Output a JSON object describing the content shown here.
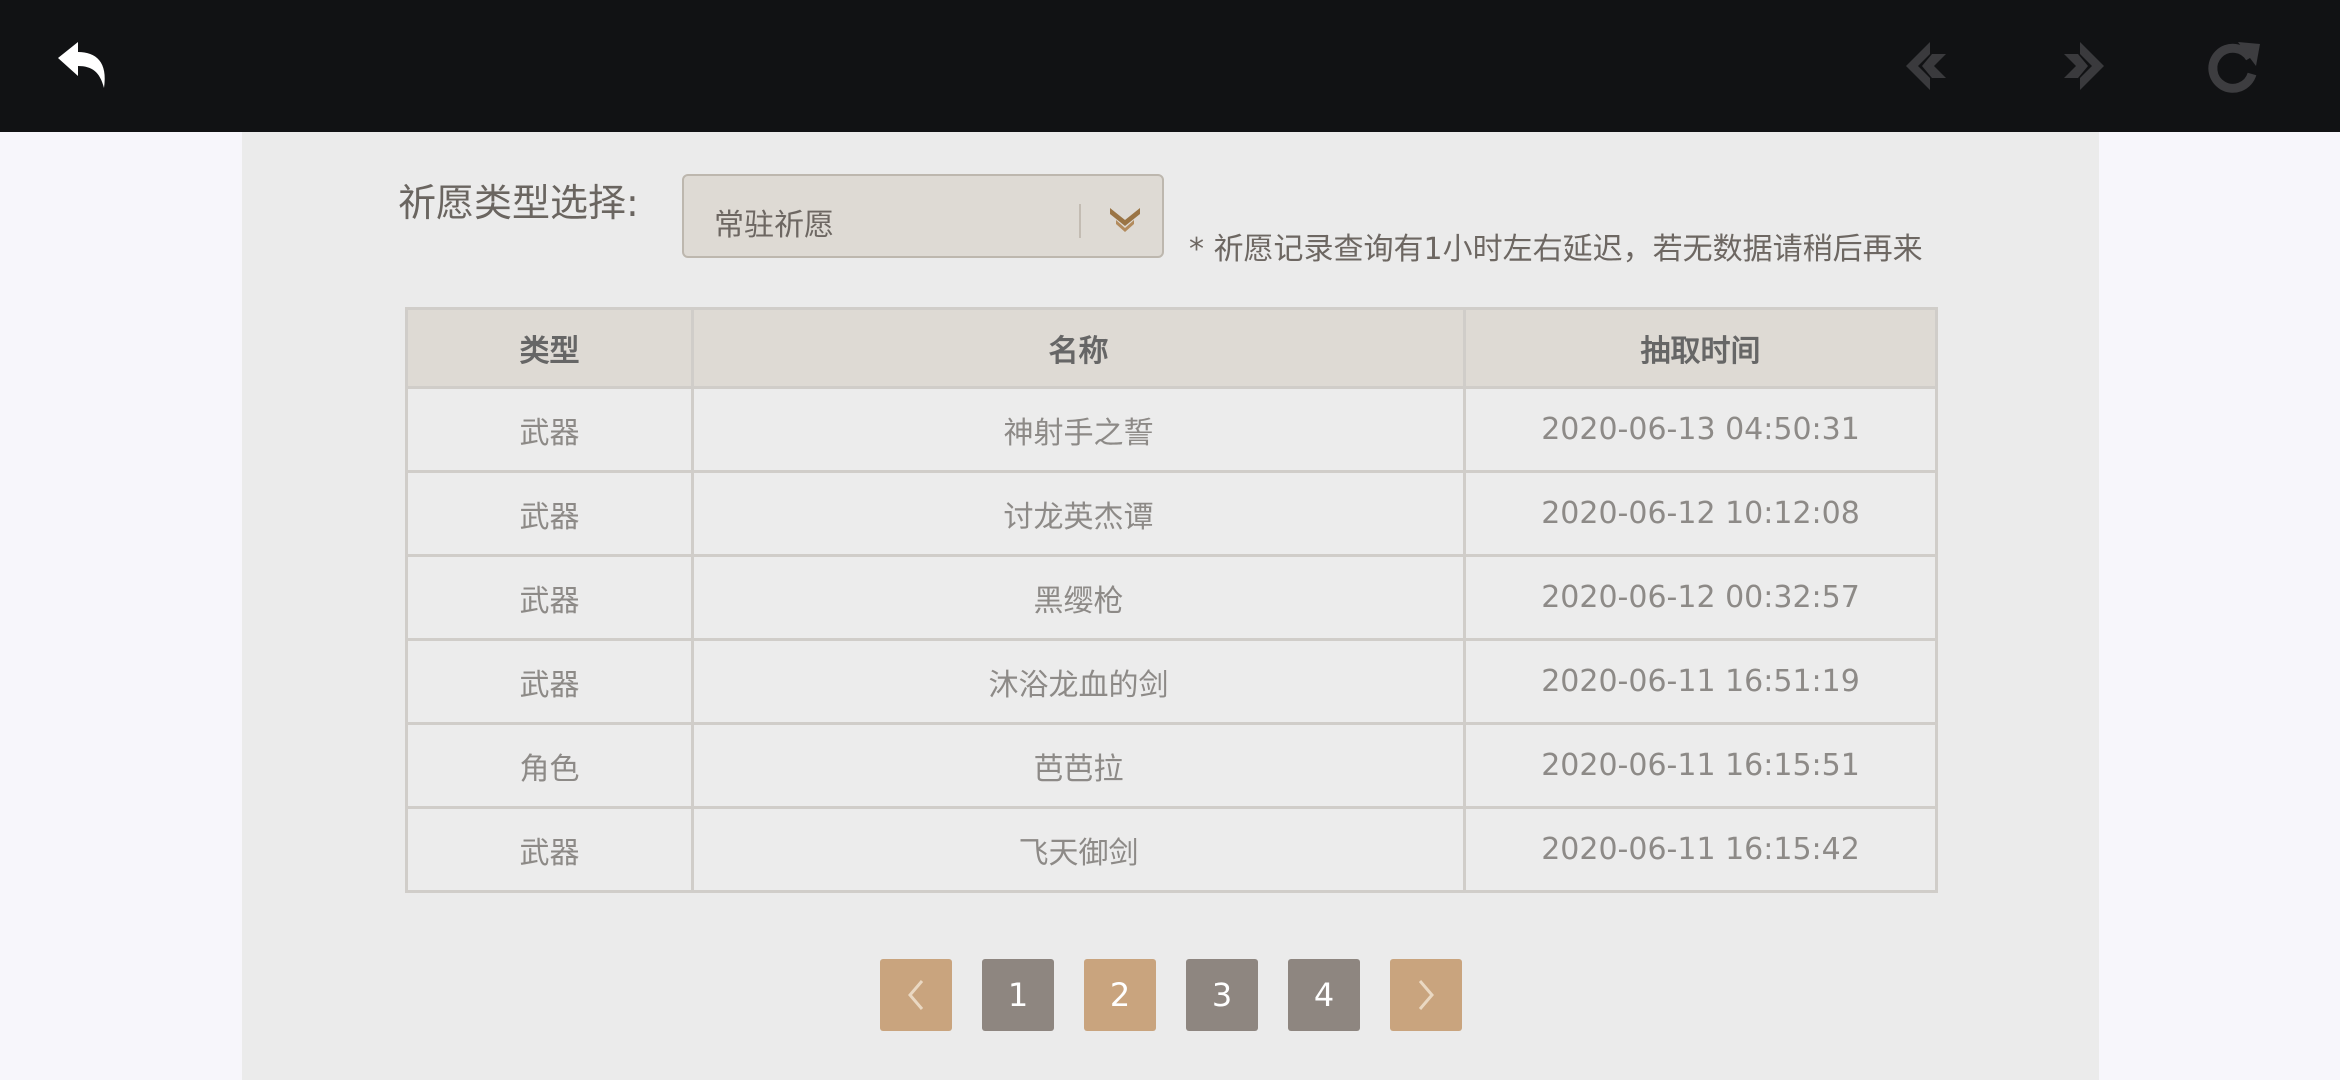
{
  "toolbar": {
    "back_icon": "back-arrow-icon",
    "prev_icon": "nav-back-icon",
    "next_icon": "nav-forward-icon",
    "reload_icon": "reload-icon"
  },
  "filter": {
    "label": "祈愿类型选择:",
    "selected": "常驻祈愿",
    "note": "* 祈愿记录查询有1小时左右延迟，若无数据请稍后再来"
  },
  "table": {
    "headers": [
      "类型",
      "名称",
      "抽取时间"
    ],
    "rows": [
      {
        "type": "武器",
        "name": "神射手之誓",
        "time": "2020-06-13 04:50:31"
      },
      {
        "type": "武器",
        "name": "讨龙英杰谭",
        "time": "2020-06-12 10:12:08"
      },
      {
        "type": "武器",
        "name": "黑缨枪",
        "time": "2020-06-12 00:32:57"
      },
      {
        "type": "武器",
        "name": "沐浴龙血的剑",
        "time": "2020-06-11 16:51:19"
      },
      {
        "type": "角色",
        "name": "芭芭拉",
        "time": "2020-06-11 16:15:51"
      },
      {
        "type": "武器",
        "name": "飞天御剑",
        "time": "2020-06-11 16:15:42"
      }
    ]
  },
  "pagination": {
    "pages": [
      "1",
      "2",
      "3",
      "4"
    ],
    "current_page": "2"
  },
  "colors": {
    "topbar": "#111214",
    "panel": "#ebebeb",
    "accent_gold": "#c9a47e",
    "page_gray": "#8e8680"
  }
}
